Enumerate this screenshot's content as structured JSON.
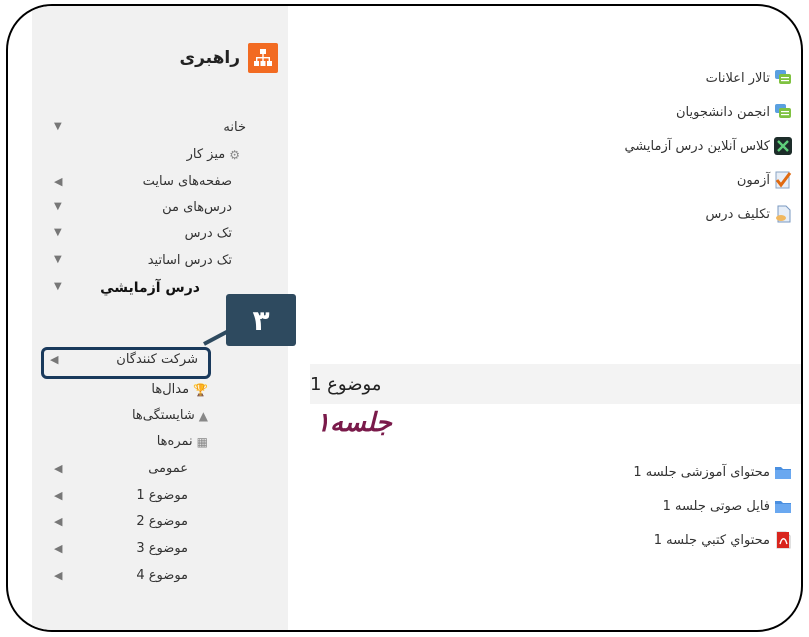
{
  "sidebar": {
    "block_title": "راهبری",
    "items": [
      {
        "label": "خانه",
        "arrow": "▼",
        "bold": false,
        "icon": ""
      },
      {
        "label": "میز کار",
        "arrow": "",
        "bold": false,
        "icon": "gear-icon"
      },
      {
        "label": "صفحه‌های سایت",
        "arrow": "◀",
        "bold": false,
        "icon": ""
      },
      {
        "label": "درس‌های من",
        "arrow": "▼",
        "bold": false,
        "icon": ""
      },
      {
        "label": "تک درس",
        "arrow": "▼",
        "bold": false,
        "icon": ""
      },
      {
        "label": "تک درس اساتید",
        "arrow": "▼",
        "bold": false,
        "icon": ""
      },
      {
        "label": "درس آزمایشي",
        "arrow": "▼",
        "bold": true,
        "icon": ""
      },
      {
        "label": "شرکت کنندگان",
        "arrow": "◀",
        "bold": false,
        "icon": ""
      },
      {
        "label": "مدال‌ها",
        "arrow": "",
        "bold": false,
        "icon": "trophy-icon"
      },
      {
        "label": "شایستگی‌ها",
        "arrow": "",
        "bold": false,
        "icon": "competency-icon"
      },
      {
        "label": "نمره‌ها",
        "arrow": "",
        "bold": false,
        "icon": "grades-icon"
      },
      {
        "label": "عمومی",
        "arrow": "◀",
        "bold": false,
        "icon": ""
      },
      {
        "label": "موضوع 1",
        "arrow": "◀",
        "bold": false,
        "icon": ""
      },
      {
        "label": "موضوع 2",
        "arrow": "◀",
        "bold": false,
        "icon": ""
      },
      {
        "label": "موضوع 3",
        "arrow": "◀",
        "bold": false,
        "icon": ""
      },
      {
        "label": "موضوع 4",
        "arrow": "◀",
        "bold": false,
        "icon": ""
      }
    ]
  },
  "callout": {
    "number": "۳"
  },
  "activities": [
    {
      "label": "تالار اعلانات",
      "icon": "forum-icon"
    },
    {
      "label": "انجمن دانشجویان",
      "icon": "forum-icon"
    },
    {
      "label": "کلاس آنلاین درس آزمایشي",
      "icon": "online-class-icon"
    },
    {
      "label": "آزمون",
      "icon": "quiz-icon"
    },
    {
      "label": "تکلیف درس",
      "icon": "assignment-icon"
    }
  ],
  "topic": {
    "title": "موضوع 1",
    "session_logo": "جلسه١",
    "resources": [
      {
        "label": "محتوای آموزشی جلسه 1",
        "icon": "folder-icon"
      },
      {
        "label": "فایل صوتی جلسه 1",
        "icon": "folder-icon"
      },
      {
        "label": "محتواي کتبي جلسه 1",
        "icon": "pdf-icon"
      }
    ]
  },
  "colors": {
    "accent": "#f26b22",
    "callout": "#2e4a5f",
    "topic_border": "#f2a33a"
  }
}
